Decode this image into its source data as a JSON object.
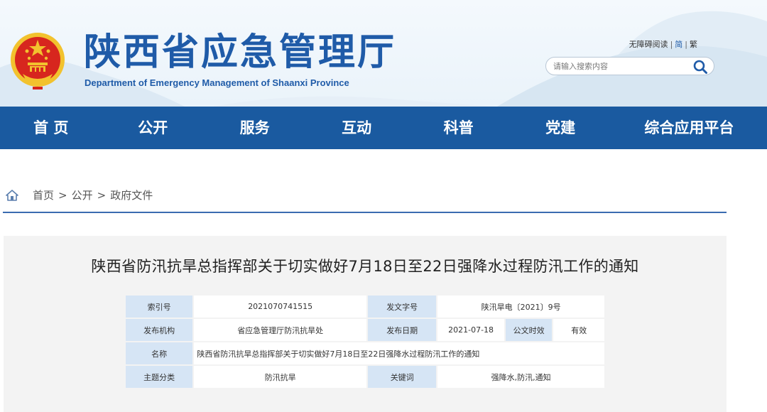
{
  "header": {
    "title": "陕西省应急管理厅",
    "subtitle": "Department of Emergency Management of Shaanxi Province",
    "tools": {
      "accessible": "无障碍阅读",
      "simplified": "简",
      "traditional": "繁",
      "separator": "|"
    },
    "search": {
      "placeholder": "请输入搜索内容"
    }
  },
  "nav": {
    "items": [
      "首 页",
      "公开",
      "服务",
      "互动",
      "科普",
      "党建",
      "综合应用平台"
    ]
  },
  "breadcrumb": {
    "items": [
      "首页",
      "公开",
      "政府文件"
    ],
    "separator": ">"
  },
  "document": {
    "title": "陕西省防汛抗旱总指挥部关于切实做好7月18日至22日强降水过程防汛工作的通知",
    "meta": {
      "index_label": "索引号",
      "index_value": "2021070741515",
      "docno_label": "发文字号",
      "docno_value": "陕汛旱电〔2021〕9号",
      "publisher_label": "发布机构",
      "publisher_value": "省应急管理厅防汛抗旱处",
      "date_label": "发布日期",
      "date_value": "2021-07-18",
      "validity_label": "公文时效",
      "validity_value": "有效",
      "name_label": "名称",
      "name_value": "陕西省防汛抗旱总指挥部关于切实做好7月18日至22日强降水过程防汛工作的通知",
      "category_label": "主题分类",
      "category_value": "防汛抗旱",
      "keywords_label": "关键词",
      "keywords_value": "强降水,防汛,通知"
    }
  },
  "colors": {
    "brand_blue": "#1f5ba8",
    "nav_blue": "#1a5aa0",
    "label_cell": "#d6e5f5",
    "emblem_red": "#d7261e",
    "emblem_gold": "#f2c22e"
  },
  "icons": [
    "national-emblem-icon",
    "search-icon",
    "home-icon"
  ]
}
